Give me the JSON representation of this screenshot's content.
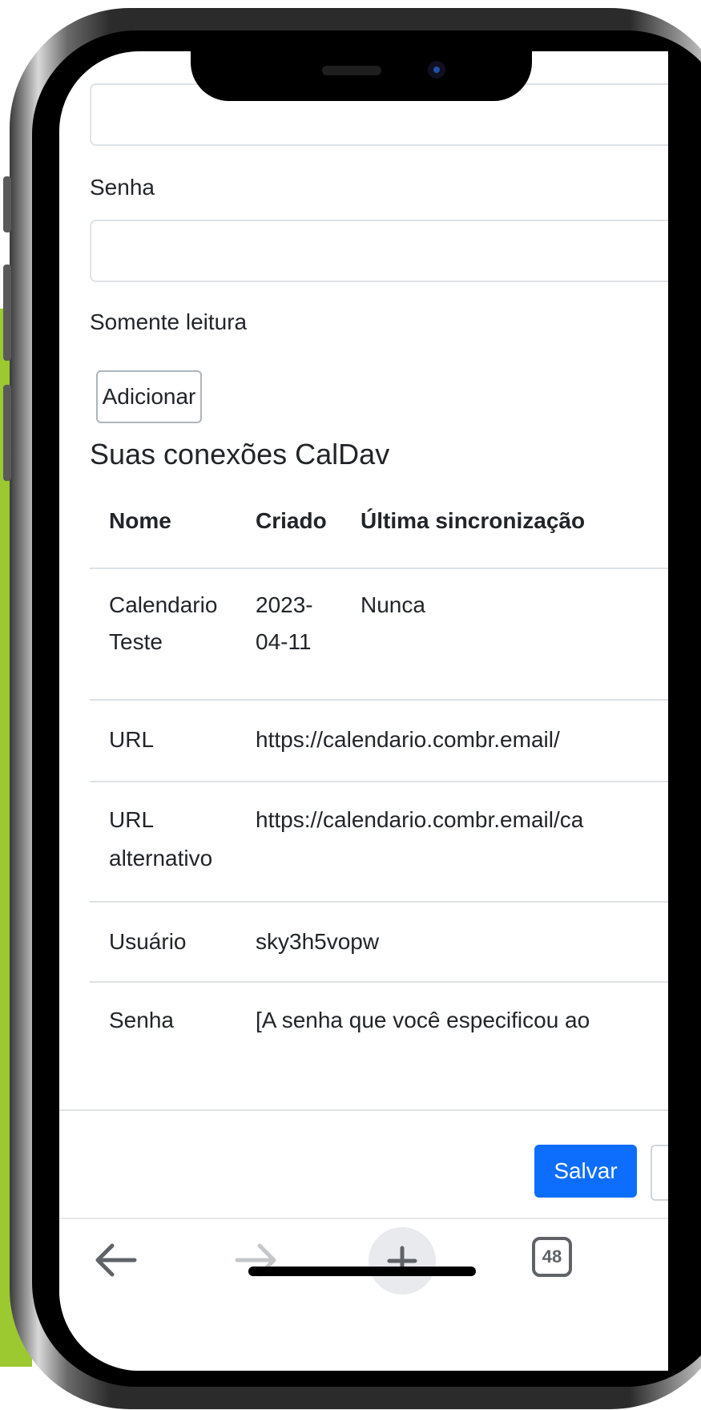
{
  "form": {
    "password_label": "Senha",
    "readonly_label": "Somente leitura",
    "add_button": "Adicionar"
  },
  "connections": {
    "title": "Suas conexões CalDav",
    "headers": [
      "Nome",
      "Criado",
      "Última sincronização"
    ],
    "row": {
      "name_line1": "Calendario",
      "name_line2": "Teste",
      "created_line1": "2023-",
      "created_line2": "04-11",
      "last_sync": "Nunca"
    },
    "details": {
      "url_label": "URL",
      "url_value": "https://calendario.combr.email/",
      "alt_url_label_line1": "URL",
      "alt_url_label_line2": "alternativo",
      "alt_url_value": "https://calendario.combr.email/ca",
      "user_label": "Usuário",
      "user_value": "sky3h5vopw",
      "password_label": "Senha",
      "password_value": "[A senha que você especificou ao"
    }
  },
  "footer": {
    "save_button": "Salvar"
  },
  "browser_toolbar": {
    "tab_count": "48",
    "icons": [
      "back-arrow-icon",
      "forward-arrow-icon",
      "plus-icon",
      "tabs-icon"
    ]
  },
  "colors": {
    "primary": "#0d6efd",
    "green_background": "#9cc830",
    "border": "#dee2e6"
  }
}
